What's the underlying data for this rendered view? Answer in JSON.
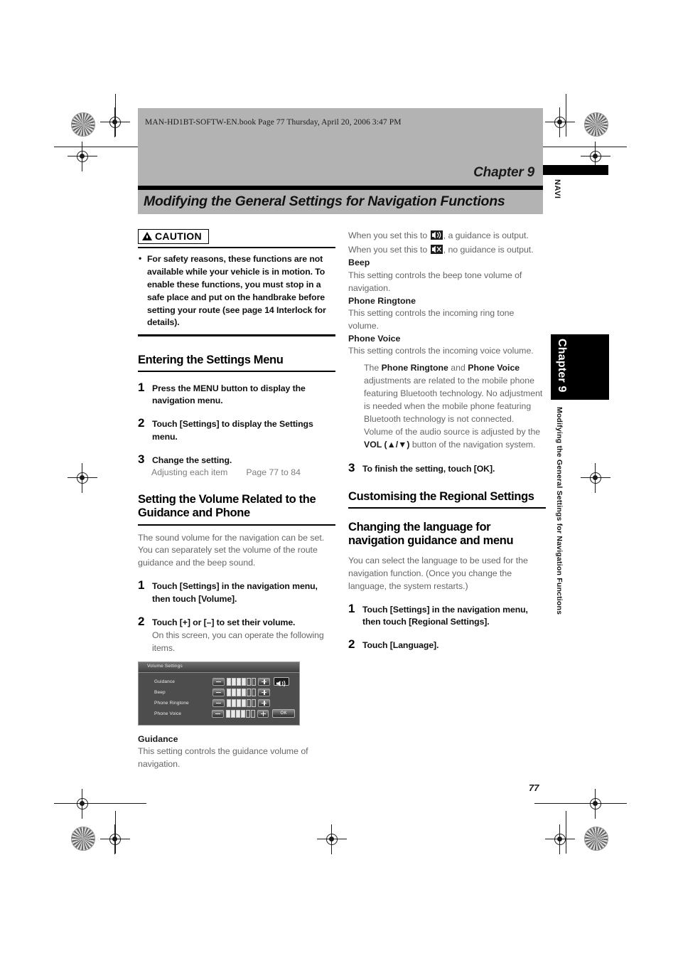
{
  "header": {
    "filename_line": "MAN-HD1BT-SOFTW-EN.book  Page 77  Thursday, April 20, 2006  3:47 PM",
    "chapter_label": "Chapter 9",
    "title": "Modifying the General Settings for Navigation Functions"
  },
  "margin": {
    "navi_tag": "NAVI",
    "chapter_tab": "Chapter 9",
    "running_head": "Modifying the General Settings for Navigation Functions",
    "page_number": "77"
  },
  "left_column": {
    "caution": {
      "badge": "CAUTION",
      "items": [
        "For safety reasons, these functions are not available while your vehicle is in motion. To enable these functions, you must stop in a safe place and put on the handbrake before setting your route (see page 14 Interlock for details)."
      ]
    },
    "section_entering": {
      "heading": "Entering the Settings Menu",
      "steps": [
        {
          "num": "1",
          "text": "Press the MENU button to display the navigation menu.",
          "bold_parts": [
            "MENU"
          ]
        },
        {
          "num": "2",
          "text": "Touch [Settings] to display the Settings menu."
        },
        {
          "num": "3",
          "text": "Change the setting."
        }
      ],
      "reference": {
        "label": "Adjusting each item",
        "target": "Page 77 to 84"
      }
    },
    "section_volume": {
      "heading": "Setting the Volume Related to the Guidance and Phone",
      "intro": "The sound volume for the navigation can be set. You can separately set the volume of the route guidance and the beep sound.",
      "steps": [
        {
          "num": "1",
          "text": "Touch [Settings] in the navigation menu, then touch [Volume]."
        },
        {
          "num": "2",
          "text": "Touch [+] or [–] to set their volume.",
          "sub": "On this screen, you can operate the following items."
        }
      ]
    },
    "screenshot": {
      "title": "Volume Settings",
      "rows": [
        {
          "label": "Guidance",
          "minus": "–",
          "plus": "+",
          "filled_bars": 4,
          "total_bars": 6,
          "extra": "speaker-icon"
        },
        {
          "label": "Beep",
          "minus": "–",
          "plus": "+",
          "filled_bars": 4,
          "total_bars": 6,
          "extra": ""
        },
        {
          "label": "Phone Ringtone",
          "minus": "–",
          "plus": "+",
          "filled_bars": 4,
          "total_bars": 6,
          "extra": ""
        },
        {
          "label": "Phone Voice",
          "minus": "–",
          "plus": "+",
          "filled_bars": 4,
          "total_bars": 6,
          "extra": "OK"
        }
      ],
      "ok_label": "OK"
    },
    "guidance_def": {
      "term": "Guidance",
      "text": "This setting controls the guidance volume of navigation."
    }
  },
  "right_column": {
    "guidance_icons_text_a": "When you set this to ",
    "guidance_icons_text_b": ", a guidance is output. When you set this to ",
    "guidance_icons_text_c": ", no guidance is output.",
    "definitions": [
      {
        "term": "Beep",
        "text": "This setting controls the beep tone volume of navigation."
      },
      {
        "term": "Phone Ringtone",
        "text": "This setting controls the incoming ring tone volume."
      },
      {
        "term": "Phone Voice",
        "text": "This setting controls the incoming voice volume."
      }
    ],
    "note_1": {
      "lead": "The ",
      "b1": "Phone Ringtone",
      "mid": " and ",
      "b2": "Phone Voice",
      "tail": " adjustments are related to the mobile phone featuring Bluetooth technology. No adjustment is needed when the mobile phone featuring Bluetooth technology is not connected."
    },
    "note_2": {
      "lead": "Volume of the audio source is adjusted by the ",
      "b1": "VOL (▲/▼)",
      "tail": " button of the navigation system."
    },
    "step_3": {
      "num": "3",
      "text": "To finish the setting, touch [OK]."
    },
    "section_regional": {
      "heading": "Customising the Regional Settings"
    },
    "section_language": {
      "heading": "Changing the language for navigation guidance and menu",
      "intro": "You can select the language to be used for the navigation function. (Once you change the language, the system restarts.)",
      "steps": [
        {
          "num": "1",
          "text": "Touch [Settings] in the navigation menu, then touch [Regional Settings]."
        },
        {
          "num": "2",
          "text": "Touch [Language]."
        }
      ]
    }
  },
  "icons": {
    "speaker_on": "speaker-on-icon",
    "speaker_off": "speaker-muted-icon",
    "caution_triangle": "warning-triangle-icon"
  },
  "colors": {
    "band": "#b3b3b3",
    "rule": "#000000",
    "body_text": "#666666",
    "heading_text": "#000000"
  }
}
